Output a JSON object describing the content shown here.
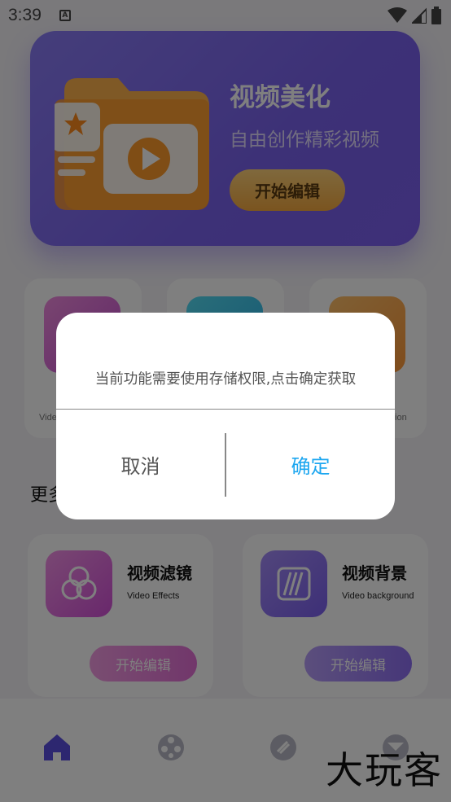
{
  "status_bar": {
    "time": "3:39",
    "notification_icon": "A"
  },
  "hero": {
    "title": "视频美化",
    "subtitle": "自由创作精彩视频",
    "button_label": "开始编辑"
  },
  "features": [
    {
      "sub_label": "Vide",
      "color": "#f07bd8"
    },
    {
      "sub_label": "",
      "color": "#3ad0ee"
    },
    {
      "sub_label": "tion",
      "color": "#ffb04f"
    }
  ],
  "section_title": "更多",
  "tools": [
    {
      "name": "视频滤镜",
      "en": "Video Effects",
      "button_label": "开始编辑",
      "icon": "circles-icon"
    },
    {
      "name": "视频背景",
      "en": "Video background",
      "button_label": "开始编辑",
      "icon": "stripes-icon"
    }
  ],
  "nav": [
    "home-icon",
    "film-reel-icon",
    "link-icon",
    "profile-icon"
  ],
  "watermark": "大玩客",
  "dialog": {
    "message": "当前功能需要使用存储权限,点击确定获取",
    "cancel_label": "取消",
    "confirm_label": "确定"
  },
  "colors": {
    "accent": "#1ea7f0",
    "hero": "#7c5ff0",
    "button_orange": "#f5a93f"
  }
}
